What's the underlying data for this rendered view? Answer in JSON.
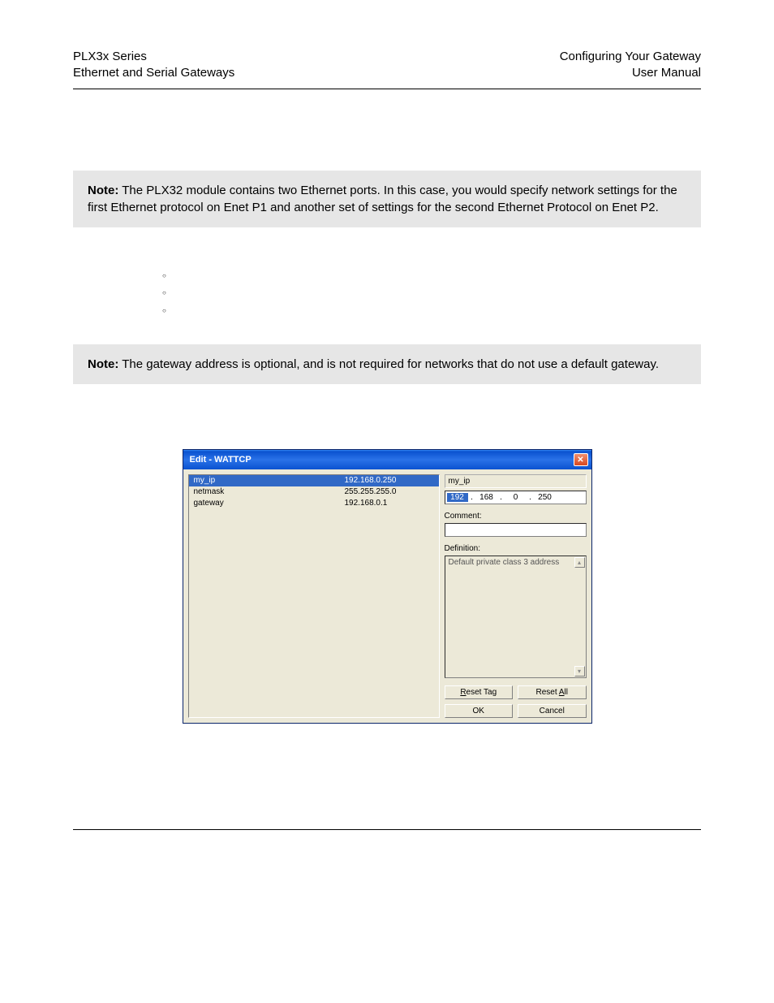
{
  "header": {
    "left_top": "PLX3x Series",
    "left_bottom": "Ethernet and Serial Gateways",
    "right_top": "Configuring Your Gateway",
    "right_bottom": "User Manual"
  },
  "note1": {
    "prefix": "Note:",
    "text": " The PLX32 module contains two Ethernet ports. In this case, you would specify network settings for the first Ethernet protocol on Enet P1 and another set of settings for the second Ethernet Protocol on Enet P2."
  },
  "note2": {
    "prefix": "Note:",
    "text": " The gateway address is optional, and is not required for networks that do not use a default gateway."
  },
  "dialog": {
    "title": "Edit - WATTCP",
    "list": [
      {
        "name": "my_ip",
        "value": "192.168.0.250",
        "selected": true
      },
      {
        "name": "netmask",
        "value": "255.255.255.0",
        "selected": false
      },
      {
        "name": "gateway",
        "value": "192.168.0.1",
        "selected": false
      }
    ],
    "field_name": "my_ip",
    "ip": {
      "a": "192",
      "b": "168",
      "c": "0",
      "d": "250"
    },
    "comment_label": "Comment:",
    "comment_value": "",
    "definition_label": "Definition:",
    "definition_text": "Default private class 3 address",
    "buttons": {
      "reset_tag": "Reset Tag",
      "reset_all": "Reset All",
      "ok": "OK",
      "cancel": "Cancel"
    }
  }
}
